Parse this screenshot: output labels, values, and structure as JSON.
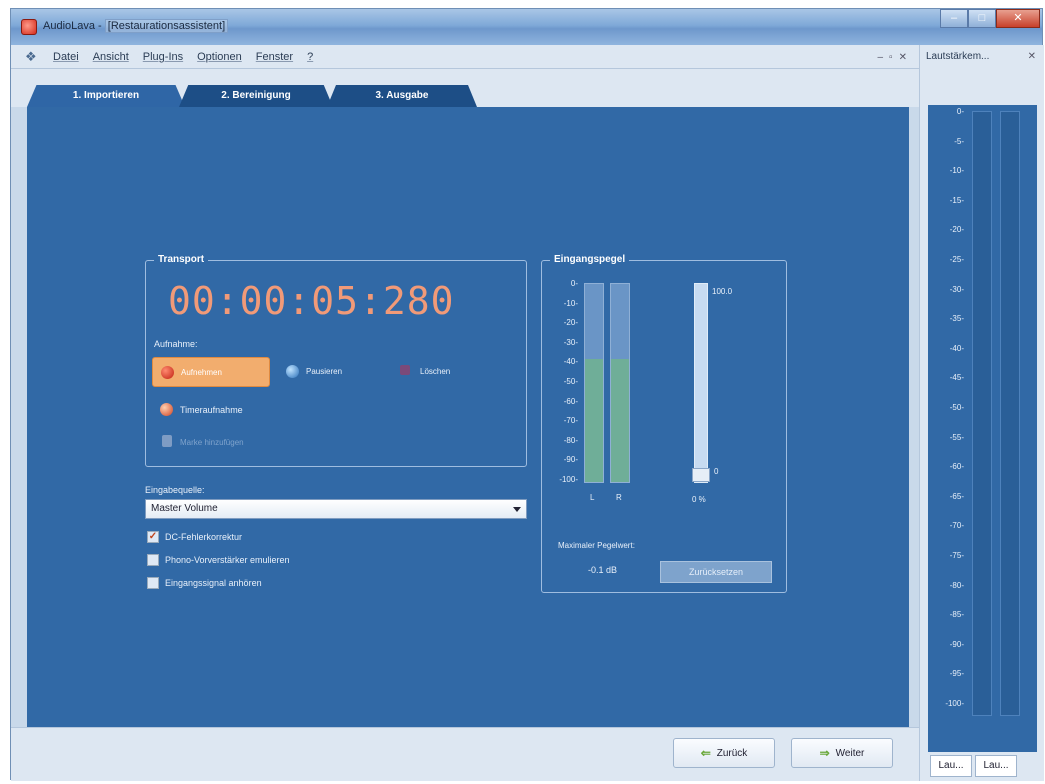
{
  "window": {
    "app_name": "AudioLava - ",
    "doc_name": "[Restaurationsassistent]"
  },
  "menu": {
    "items": [
      "Datei",
      "Ansicht",
      "Plug-Ins",
      "Optionen",
      "Fenster",
      "?"
    ]
  },
  "tabs": [
    {
      "label": "1. Importieren",
      "active": true
    },
    {
      "label": "2. Bereinigung",
      "active": false
    },
    {
      "label": "3. Ausgabe",
      "active": false
    }
  ],
  "transport": {
    "title": "Transport",
    "time": "00:00:05:280",
    "recording_label": "Aufnahme:",
    "record": "Aufnehmen",
    "pause": "Pausieren",
    "delete": "Löschen",
    "timer_record": "Timeraufnahme",
    "add_marker": "Marke hinzufügen"
  },
  "input": {
    "source_label": "Eingabequelle:",
    "source_value": "Master Volume",
    "options": [
      {
        "label": "DC-Fehlerkorrektur",
        "checked": true
      },
      {
        "label": "Phono-Vorverstärker emulieren",
        "checked": false
      },
      {
        "label": "Eingangssignal anhören",
        "checked": false
      }
    ]
  },
  "level": {
    "title": "Eingangspegel",
    "scale": [
      "0-",
      "-10-",
      "-20-",
      "-30-",
      "-40-",
      "-50-",
      "-60-",
      "-70-",
      "-80-",
      "-90-",
      "-100-"
    ],
    "channel_labels": [
      "L",
      "R"
    ],
    "channel_fill": [
      0.62,
      0.62
    ],
    "slider_max": "100.0",
    "slider_min": "0",
    "slider_value": "0 %",
    "peak_label": "Maximaler Pegelwert:",
    "peak_value": "-0.1 dB",
    "reset": "Zurücksetzen"
  },
  "footer": {
    "back": "Zurück",
    "next": "Weiter"
  },
  "right_panel": {
    "title": "Lautstärkem...",
    "scale": [
      "0-",
      "-5-",
      "-10-",
      "-15-",
      "-20-",
      "-25-",
      "-30-",
      "-35-",
      "-40-",
      "-45-",
      "-50-",
      "-55-",
      "-60-",
      "-65-",
      "-70-",
      "-75-",
      "-80-",
      "-85-",
      "-90-",
      "-95-",
      "-100-"
    ],
    "tabs": [
      "Lau...",
      "Lau..."
    ]
  }
}
